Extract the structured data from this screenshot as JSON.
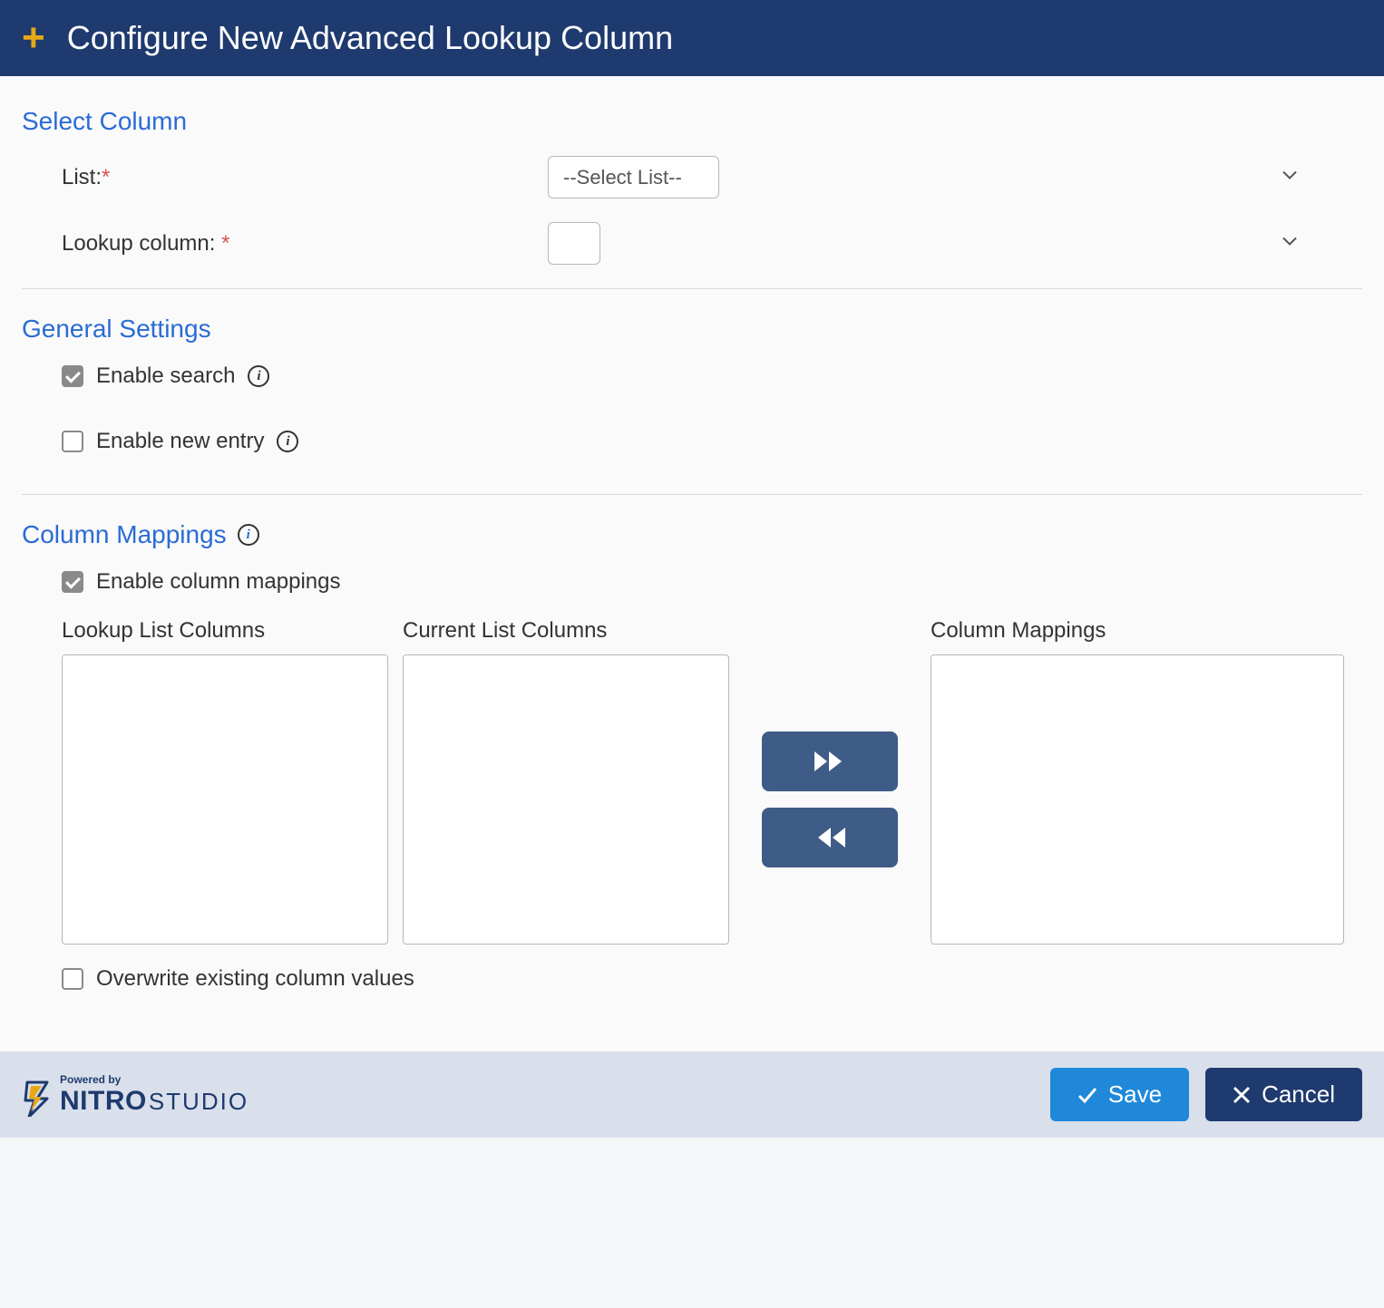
{
  "header": {
    "title": "Configure New Advanced Lookup Column"
  },
  "sections": {
    "selectColumn": {
      "title": "Select Column",
      "fields": {
        "list": {
          "label": "List:",
          "required": "*",
          "placeholder": "--Select List--"
        },
        "lookup": {
          "label": "Lookup column: ",
          "required": "*",
          "placeholder": ""
        }
      }
    },
    "generalSettings": {
      "title": "General Settings",
      "enableSearch": {
        "label": "Enable search",
        "checked": true
      },
      "enableNewEntry": {
        "label": "Enable new entry",
        "checked": false
      }
    },
    "columnMappings": {
      "title": "Column Mappings",
      "enableMappings": {
        "label": "Enable column mappings",
        "checked": true
      },
      "columns": {
        "lookupList": "Lookup List Columns",
        "currentList": "Current List Columns",
        "mappings": "Column Mappings"
      },
      "overwrite": {
        "label": "Overwrite existing column values",
        "checked": false
      }
    }
  },
  "footer": {
    "poweredBy": "Powered by",
    "brand": "NITRO",
    "studio": "STUDIO",
    "save": "Save",
    "cancel": "Cancel"
  }
}
